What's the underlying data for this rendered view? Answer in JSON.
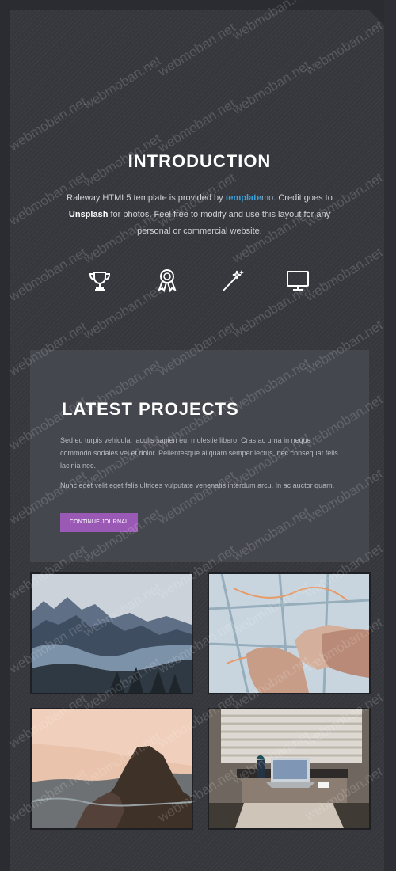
{
  "intro": {
    "title": "INTRODUCTION",
    "text_start": "Raleway HTML5 template is provided by ",
    "brand_main": "template",
    "brand_tail": "mo",
    "text_mid": ". Credit goes to ",
    "unsplash": "Unsplash",
    "text_end": " for photos. Feel free to modify and use this layout for any personal or commercial website."
  },
  "features": [
    {
      "icon": "trophy-icon"
    },
    {
      "icon": "award-ribbon-icon"
    },
    {
      "icon": "magic-wand-icon"
    },
    {
      "icon": "monitor-icon"
    }
  ],
  "projects": {
    "title": "LATEST PROJECTS",
    "paragraph_1": "Sed eu turpis vehicula, iaculis sapien eu, molestie libero. Cras ac urna in neque commodo sodales vel et dolor. Pellentesque aliquam semper lectus, nec consequat felis lacinia nec.",
    "paragraph_2": "Nunc eget velit eget felis ultrices vulputate venenatis interdum arcu. In ac auctor quam.",
    "button_label": "CONTINUE JOURNAL"
  },
  "gallery": [
    {
      "name": "mountain-lake-photo"
    },
    {
      "name": "map-hand-photo"
    },
    {
      "name": "sea-cliff-photo"
    },
    {
      "name": "laptop-desk-photo"
    }
  ],
  "watermark": "webmoban.net",
  "colors": {
    "background": "#35373d",
    "panel": "#45474e",
    "accent": "#3aa3dc",
    "button": "#9b59b6"
  }
}
